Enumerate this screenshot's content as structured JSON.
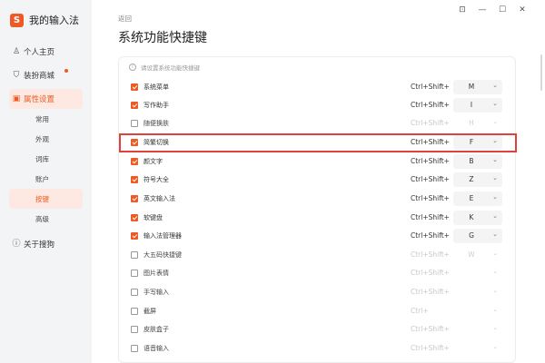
{
  "sidebar": {
    "brand_logo": "S",
    "brand_title": "我的输入法",
    "items": [
      {
        "label": "个人主页",
        "icon": "user-icon"
      },
      {
        "label": "装扮商城",
        "icon": "shirt-icon"
      },
      {
        "label": "属性设置",
        "icon": "settings-icon"
      }
    ],
    "sub_items": [
      "常用",
      "外观",
      "词库",
      "账户",
      "按键",
      "高级"
    ],
    "about": {
      "label": "关于搜狗",
      "icon": "info-icon"
    }
  },
  "header": {
    "back": "返回",
    "title": "系统功能快捷键",
    "window_buttons": [
      "pin-icon",
      "minimize-icon",
      "maximize-icon",
      "close-icon"
    ]
  },
  "hint": "请设置系统功能快捷键",
  "shortcuts": [
    {
      "label": "系统菜单",
      "checked": true,
      "modifier": "Ctrl+Shift+",
      "key": "M"
    },
    {
      "label": "写作助手",
      "checked": true,
      "modifier": "Ctrl+Shift+",
      "key": "I"
    },
    {
      "label": "随便换肤",
      "checked": false,
      "modifier": "Ctrl+Shift+",
      "key": "H"
    },
    {
      "label": "简繁切换",
      "checked": true,
      "modifier": "Ctrl+Shift+",
      "key": "F"
    },
    {
      "label": "颜文字",
      "checked": true,
      "modifier": "Ctrl+Shift+",
      "key": "B"
    },
    {
      "label": "符号大全",
      "checked": true,
      "modifier": "Ctrl+Shift+",
      "key": "Z"
    },
    {
      "label": "英文输入法",
      "checked": true,
      "modifier": "Ctrl+Shift+",
      "key": "E"
    },
    {
      "label": "软键盘",
      "checked": true,
      "modifier": "Ctrl+Shift+",
      "key": "K"
    },
    {
      "label": "输入法管理器",
      "checked": true,
      "modifier": "Ctrl+Shift+",
      "key": "G"
    },
    {
      "label": "大五码快捷键",
      "checked": false,
      "modifier": "Ctrl+Shift+",
      "key": "W"
    },
    {
      "label": "图片表情",
      "checked": false,
      "modifier": "Ctrl+Shift+",
      "key": ""
    },
    {
      "label": "手写输入",
      "checked": false,
      "modifier": "Ctrl+Shift+",
      "key": ""
    },
    {
      "label": "截屏",
      "checked": false,
      "modifier": "Ctrl+",
      "key": ""
    },
    {
      "label": "皮肤盒子",
      "checked": false,
      "modifier": "Ctrl+Shift+",
      "key": ""
    },
    {
      "label": "语音输入",
      "checked": false,
      "modifier": "Ctrl+Shift+",
      "key": ""
    }
  ],
  "colors": {
    "accent": "#ee5a24",
    "highlight_box": "#e0413f"
  }
}
